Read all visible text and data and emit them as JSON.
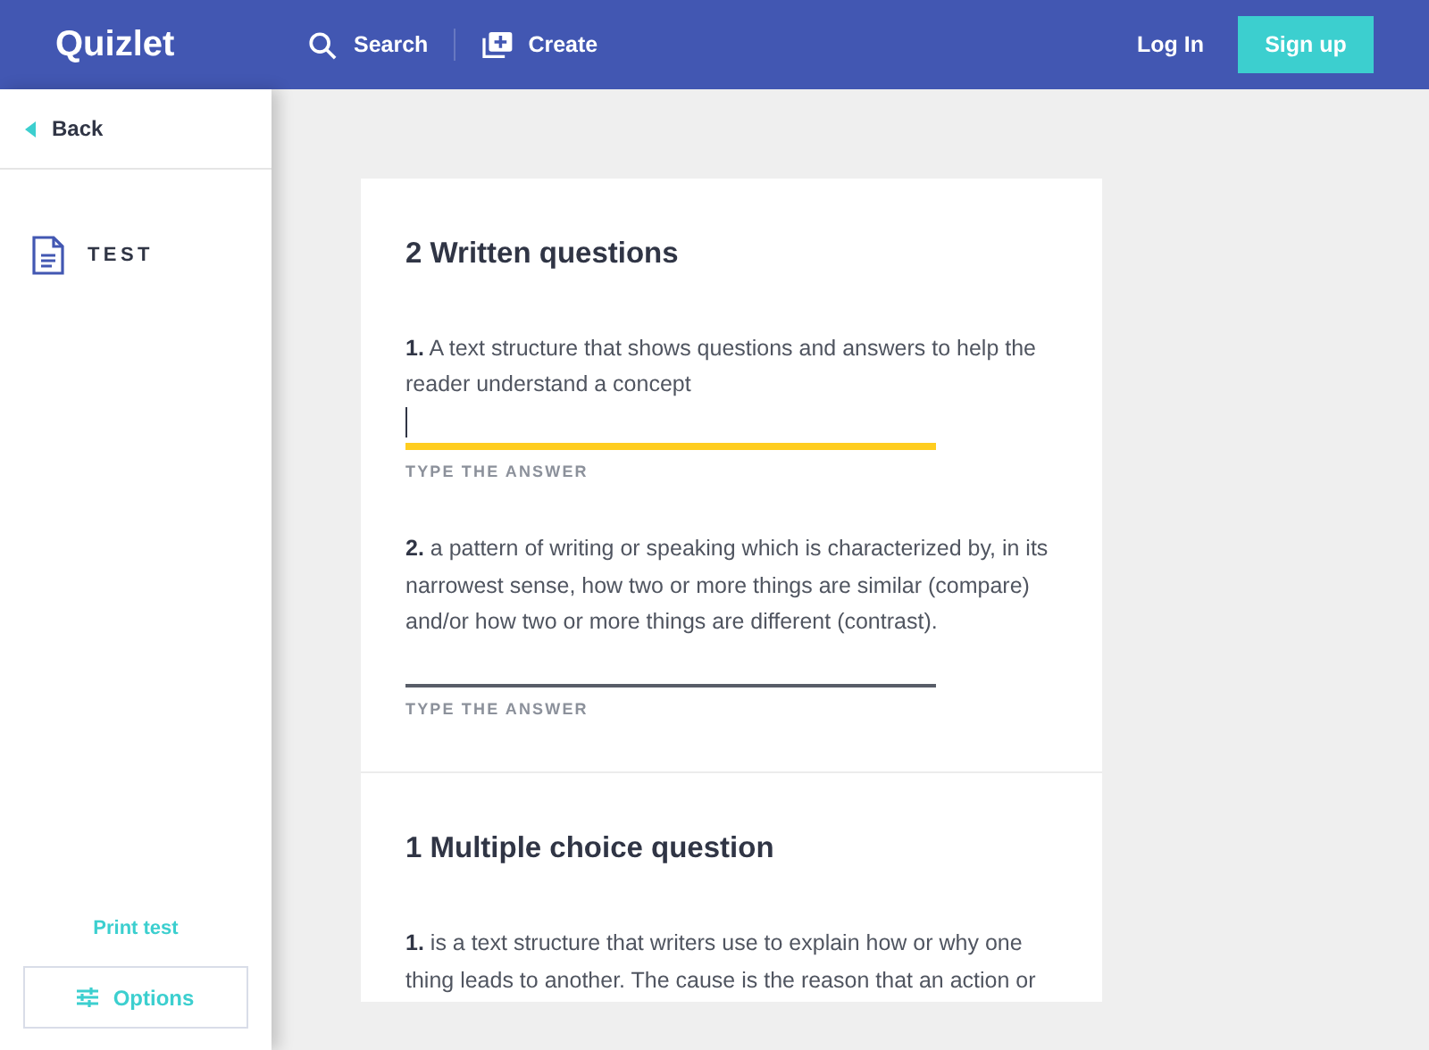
{
  "header": {
    "logo": "Quizlet",
    "nav": [
      {
        "kind": "search",
        "label": "Search"
      },
      {
        "kind": "create",
        "label": "Create"
      }
    ],
    "login": "Log In",
    "signup": "Sign up"
  },
  "sidebar": {
    "back": "Back",
    "items": [
      {
        "label": "TEST",
        "selected": true
      }
    ],
    "print": "Print test",
    "options": "Options"
  },
  "sections": [
    {
      "title": "2 Written questions",
      "questions": [
        {
          "number": "1.",
          "text": "A text structure that shows questions and answers to help the reader understand a concept",
          "answer": {
            "focused": true,
            "hint": "TYPE THE ANSWER"
          }
        },
        {
          "number": "2.",
          "text": "a pattern of writing or speaking which is characterized by, in its narrowest sense, how two or more things are similar (compare) and/or how two or more things are different (contrast).",
          "answer": {
            "focused": false,
            "hint": "TYPE THE ANSWER"
          }
        }
      ]
    },
    {
      "title": "1 Multiple choice question",
      "questions": [
        {
          "number": "1.",
          "text": "is a text structure that writers use to explain how or why one thing leads to another. The cause is the reason that an action or"
        }
      ]
    }
  ]
}
